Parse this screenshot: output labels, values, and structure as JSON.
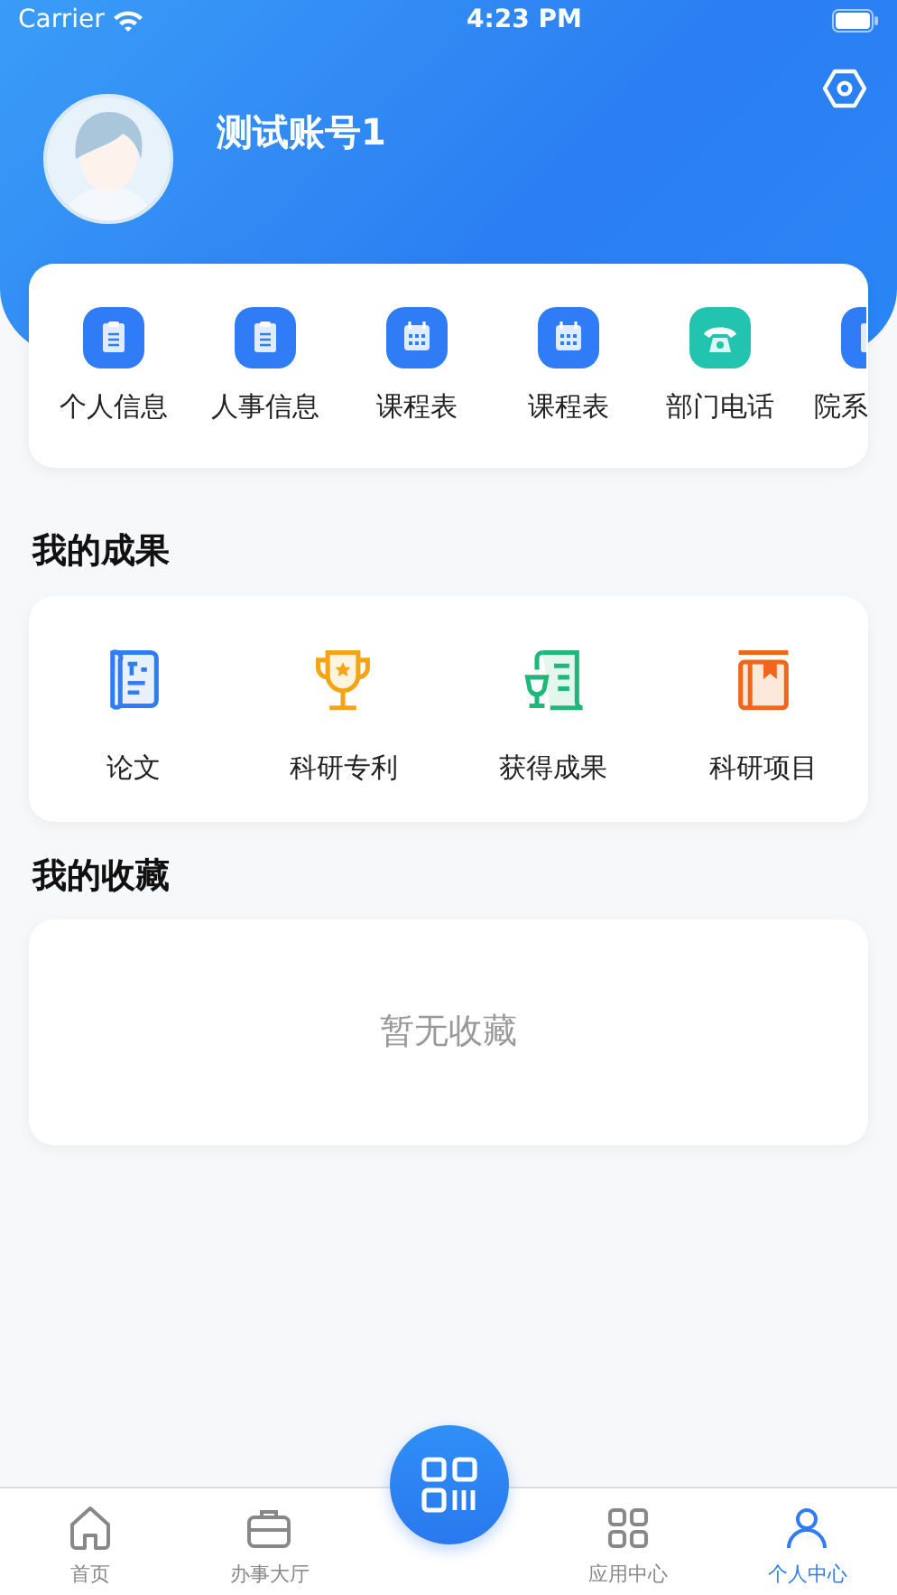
{
  "status_bar": {
    "carrier": "Carrier",
    "time": "4:23 PM"
  },
  "profile": {
    "name": "测试账号1"
  },
  "quick_links": [
    {
      "label": "个人信息",
      "kind": "list",
      "color": "#2f7cf6"
    },
    {
      "label": "人事信息",
      "kind": "list",
      "color": "#2f7cf6"
    },
    {
      "label": "课程表",
      "kind": "calendar",
      "color": "#2f7cf6"
    },
    {
      "label": "课程表",
      "kind": "calendar",
      "color": "#2f7cf6"
    },
    {
      "label": "部门电话",
      "kind": "phone",
      "color": "#22c4b0"
    },
    {
      "label": "院系",
      "kind": "cut",
      "color": "#2f7cf6"
    }
  ],
  "achievements": {
    "title": "我的成果",
    "items": [
      {
        "label": "论文",
        "kind": "paper"
      },
      {
        "label": "科研专利",
        "kind": "trophy"
      },
      {
        "label": "获得成果",
        "kind": "scroll"
      },
      {
        "label": "科研项目",
        "kind": "book"
      }
    ]
  },
  "favorites": {
    "title": "我的收藏",
    "empty_text": "暂无收藏"
  },
  "tab_bar": [
    {
      "label": "首页",
      "kind": "home",
      "selected": false
    },
    {
      "label": "办事大厅",
      "kind": "briefcase",
      "selected": false
    },
    {
      "label": "应用中心",
      "kind": "apps",
      "selected": false
    },
    {
      "label": "个人中心",
      "kind": "person",
      "selected": true
    }
  ]
}
